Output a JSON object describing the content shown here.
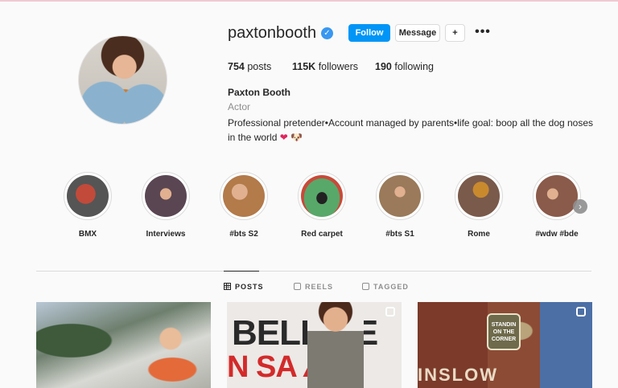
{
  "profile": {
    "username": "paxtonbooth",
    "follow_label": "Follow",
    "message_label": "Message",
    "suggest_label": "+",
    "more_label": "•••",
    "stats": {
      "posts_num": "754",
      "posts_label": "posts",
      "followers_num": "115K",
      "followers_label": "followers",
      "following_num": "190",
      "following_label": "following"
    },
    "full_name": "Paxton Booth",
    "category": "Actor",
    "bio": "Professional pretender•Account managed by parents•life goal: boop all the dog noses in the world",
    "bio_emoji": "❤ 🐶"
  },
  "highlights": [
    {
      "label": "BMX",
      "color": "#c24a3a"
    },
    {
      "label": "Interviews",
      "color": "#5a4652"
    },
    {
      "label": "#bts S2",
      "color": "#b37a4a"
    },
    {
      "label": "Red carpet",
      "color": "#58a86a"
    },
    {
      "label": "#bts S1",
      "color": "#9a7a5a"
    },
    {
      "label": "Rome",
      "color": "#c98a2e"
    },
    {
      "label": "#wdw #bde",
      "color": "#8a5a4a"
    }
  ],
  "tabs": {
    "posts": "POSTS",
    "reels": "REELS",
    "tagged": "TAGGED"
  },
  "posts": {
    "post2_line1": "BELIEVE",
    "post2_line2": "N SA▲A",
    "post3_sign": "STANDIN ON THE CORNER",
    "post3_text": "INSLOW"
  },
  "colors": {
    "accent": "#0095f6",
    "verified": "#3897f0"
  }
}
